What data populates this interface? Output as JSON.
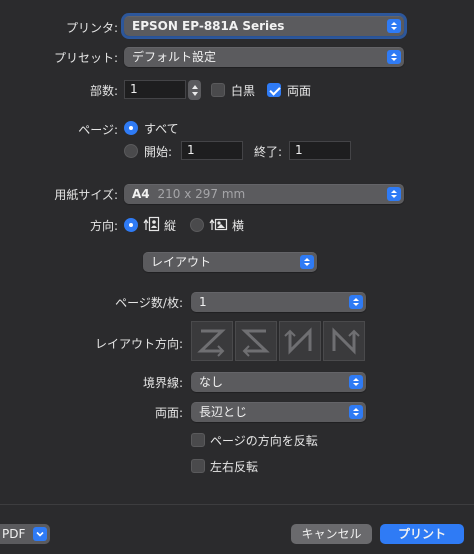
{
  "printer": {
    "label": "プリンタ:",
    "value": "EPSON EP-881A Series"
  },
  "preset": {
    "label": "プリセット:",
    "value": "デフォルト設定"
  },
  "copies": {
    "label": "部数:",
    "value": "1",
    "bw_label": "白黒",
    "bw_checked": false,
    "duplex_label": "両面",
    "duplex_checked": true
  },
  "pages": {
    "label": "ページ:",
    "all_label": "すべて",
    "range_label": "開始:",
    "from": "1",
    "to_label": "終了:",
    "to": "1"
  },
  "paper_size": {
    "label": "用紙サイズ:",
    "name": "A4",
    "dims": "210 x 297 mm"
  },
  "orientation": {
    "label": "方向:",
    "portrait_label": "縦",
    "landscape_label": "横",
    "selected": "portrait"
  },
  "section_popup": {
    "value": "レイアウト"
  },
  "layout": {
    "pages_per_sheet_label": "ページ数/枚:",
    "pages_per_sheet": "1",
    "direction_label": "レイアウト方向:",
    "border_label": "境界線:",
    "border": "なし",
    "duplex_label": "両面:",
    "duplex": "長辺とじ",
    "reverse_orientation_label": "ページの方向を反転",
    "reverse_orientation_checked": false,
    "flip_horizontal_label": "左右反転",
    "flip_horizontal_checked": false
  },
  "footer": {
    "pdf_label": "PDF",
    "cancel_label": "キャンセル",
    "print_label": "プリント"
  },
  "colors": {
    "accent": "#2f7bf5",
    "background": "#2b2b2d",
    "popup": "#5b5b5e"
  }
}
